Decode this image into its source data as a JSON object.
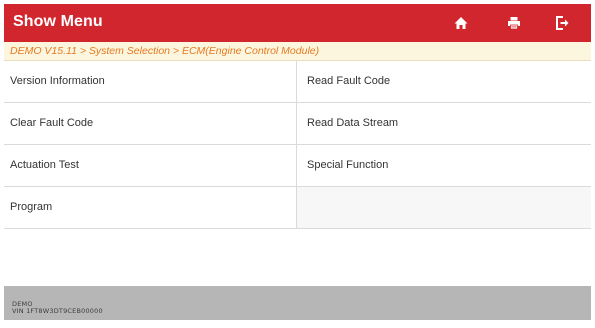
{
  "header": {
    "title": "Show Menu",
    "buttons": [
      {
        "name": "home",
        "icon": "home-icon"
      },
      {
        "name": "print",
        "icon": "printer-icon"
      },
      {
        "name": "exit",
        "icon": "exit-icon"
      }
    ],
    "color": "#d2262e"
  },
  "breadcrumb": {
    "text": "DEMO V15.11 > System Selection > ECM(Engine Control Module)",
    "color": "#e6791f",
    "background": "#fcf6df"
  },
  "menu": {
    "items": [
      "Version Information",
      "Read Fault Code",
      "Clear Fault Code",
      "Read Data Stream",
      "Actuation Test",
      "Special Function",
      "Program",
      ""
    ]
  },
  "footer": {
    "line1": "DEMO",
    "line2": "VIN 1FT8W3DT9CEB00000"
  }
}
